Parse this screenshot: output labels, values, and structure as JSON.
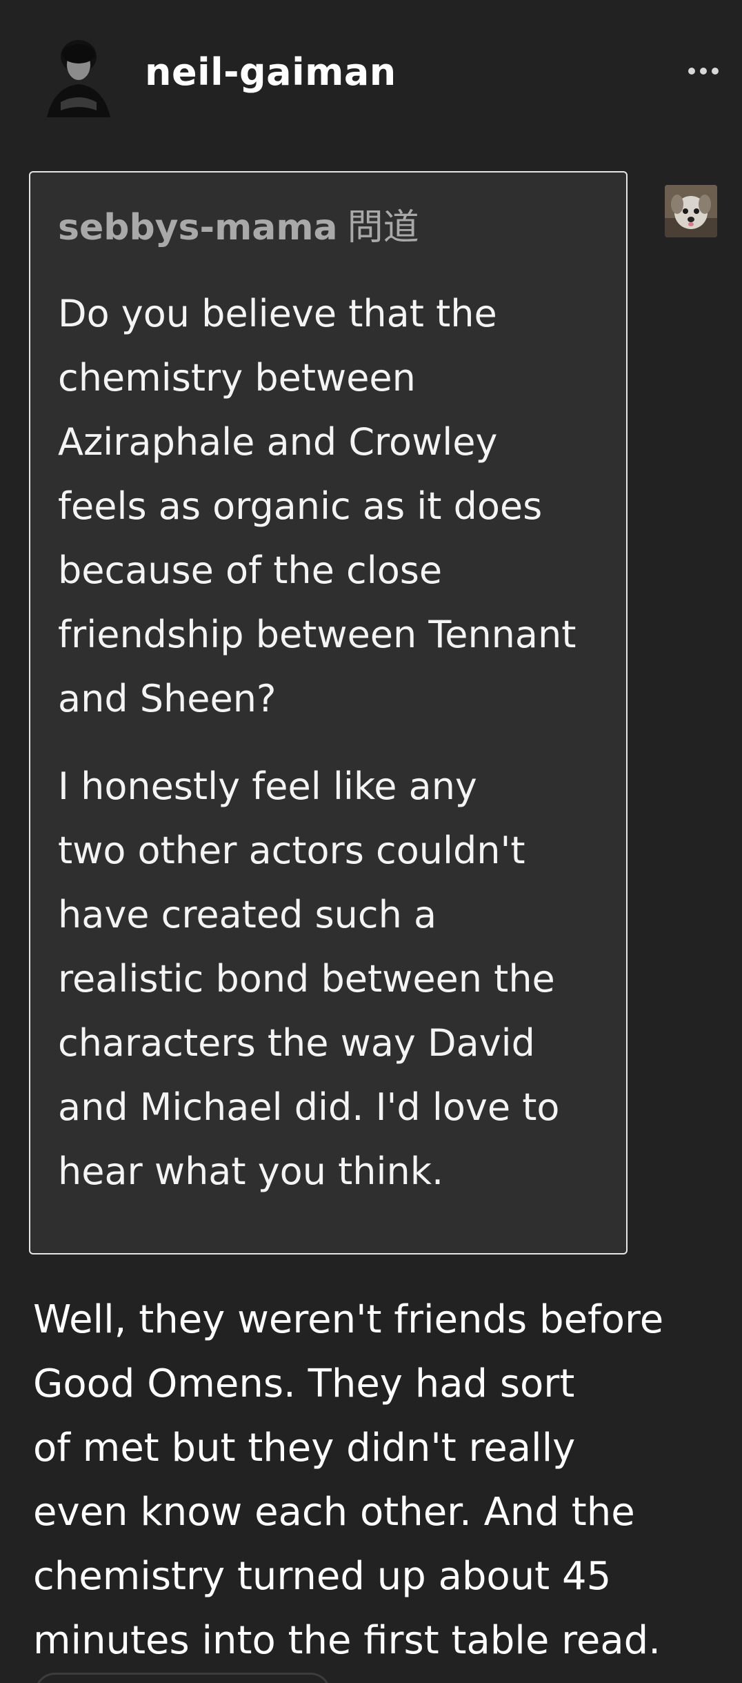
{
  "post": {
    "blog_name": "neil-gaiman",
    "avatar_icon": "author-portrait-avatar",
    "more_icon": "ellipsis-icon"
  },
  "ask": {
    "asker_name": "sebbys-mama",
    "asked_label": "問道",
    "asker_avatar_icon": "dog-avatar",
    "paragraph_1_lines": [
      "Do you believe that the",
      "chemistry between",
      "Aziraphale and Crowley",
      "feels as organic as it does",
      "because of the close",
      "friendship between Tennant",
      "and Sheen?"
    ],
    "paragraph_2_lines": [
      "I honestly feel like any",
      "two other actors couldn't",
      "have created such a",
      "realistic bond between the",
      "characters the way David",
      "and Michael did. I'd love to",
      "hear what you think."
    ]
  },
  "answer": {
    "lines": [
      "Well, they weren't friends before",
      "Good Omens. They had sort",
      "of met but they didn't really",
      "even know each other. And the",
      "chemistry turned up about 45",
      "minutes into the first table read."
    ]
  },
  "colors": {
    "background": "#222223",
    "ask_box": "#2f2f30",
    "ask_border": "#e6e6e6",
    "asker_name": "#a9a9a9",
    "text": "#ffffff"
  }
}
